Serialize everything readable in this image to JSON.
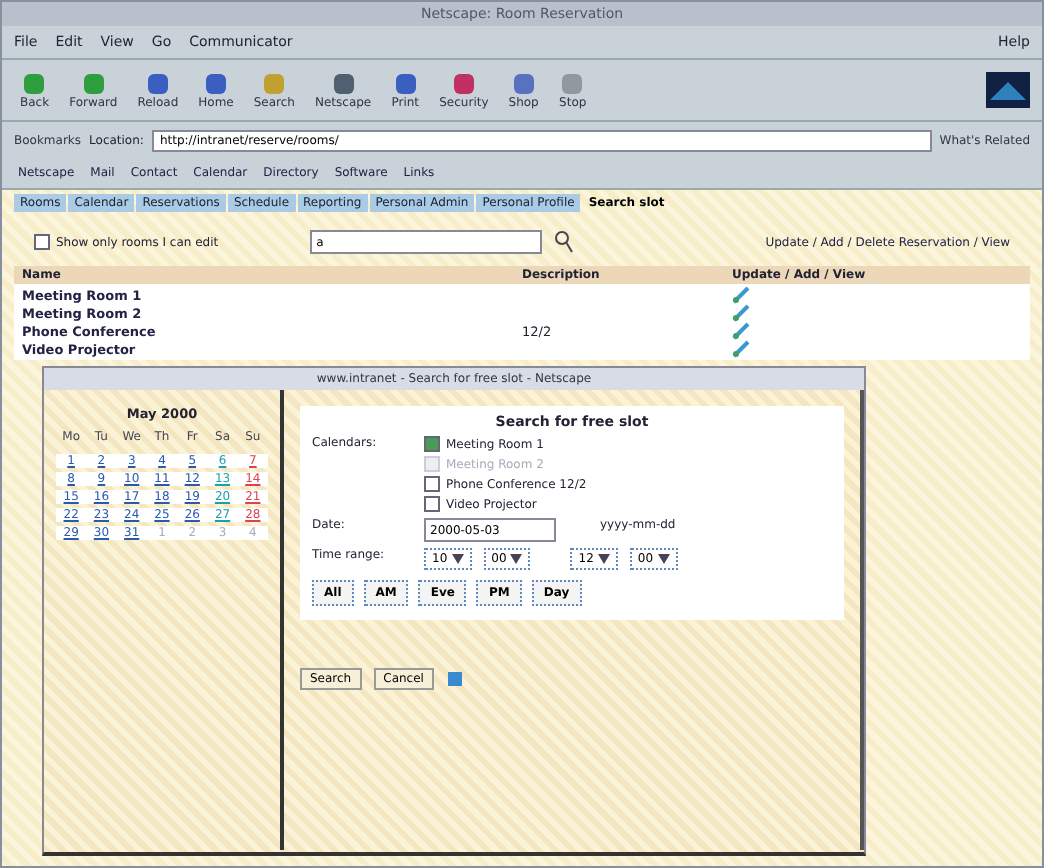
{
  "window": {
    "title": "Netscape: Room Reservation"
  },
  "menu": [
    "File",
    "Edit",
    "View",
    "Go",
    "Communicator"
  ],
  "help": "Help",
  "toolbar": [
    {
      "label": "Back",
      "color": "#2e9e3e"
    },
    {
      "label": "Forward",
      "color": "#2e9e3e"
    },
    {
      "label": "Reload",
      "color": "#3a5fc0"
    },
    {
      "label": "Home",
      "color": "#3a5fc0"
    },
    {
      "label": "Search",
      "color": "#c0a030"
    },
    {
      "label": "Netscape",
      "color": "#506070"
    },
    {
      "label": "Print",
      "color": "#3a5fc0"
    },
    {
      "label": "Security",
      "color": "#c03060"
    },
    {
      "label": "Shop",
      "color": "#5a70c0"
    },
    {
      "label": "Stop",
      "color": "#9098a0"
    }
  ],
  "location": {
    "bookmarks": "Bookmarks",
    "label": "Location:",
    "value": "http://intranet/reserve/rooms/",
    "related": "What's Related"
  },
  "personal": [
    "Netscape",
    "Mail",
    "Contact",
    "Calendar",
    "Directory",
    "Software",
    "Links"
  ],
  "tabs": [
    {
      "label": "Rooms",
      "selected": false
    },
    {
      "label": "Calendar",
      "selected": false
    },
    {
      "label": "Reservations",
      "selected": false
    },
    {
      "label": "Schedule",
      "selected": false
    },
    {
      "label": "Reporting",
      "selected": false
    },
    {
      "label": "Personal Admin",
      "selected": false
    },
    {
      "label": "Personal Profile",
      "selected": false
    },
    {
      "label": "Search slot",
      "selected": true
    }
  ],
  "filter": {
    "label": "Show only rooms I can edit",
    "checked": false,
    "value": "a"
  },
  "actions": "Update / Add / Delete Reservation / View",
  "table": {
    "columns": [
      "Name",
      "Description",
      "Update / Add / View"
    ],
    "rows": [
      {
        "name": "Meeting Room 1",
        "description": ""
      },
      {
        "name": "Meeting Room 2",
        "description": ""
      },
      {
        "name": "Phone Conference",
        "extra": "12/2"
      },
      {
        "name": "Video Projector",
        "extra": ""
      }
    ]
  },
  "popup": {
    "title": "www.intranet - Search for free slot - Netscape",
    "calendar": {
      "month": "May 2000",
      "weekdays": [
        "Mo",
        "Tu",
        "We",
        "Th",
        "Fr",
        "Sa",
        "Su"
      ],
      "weeks": [
        [
          "1",
          "2",
          "3",
          "4",
          "5",
          "6",
          "7"
        ],
        [
          "8",
          "9",
          "10",
          "11",
          "12",
          "13",
          "14"
        ],
        [
          "15",
          "16",
          "17",
          "18",
          "19",
          "20",
          "21"
        ],
        [
          "22",
          "23",
          "24",
          "25",
          "26",
          "27",
          "28"
        ],
        [
          "29",
          "30",
          "31",
          "1",
          "2",
          "3",
          "4"
        ]
      ]
    },
    "heading": "Search for free slot",
    "resources_label": "Calendars:",
    "resources": [
      {
        "label": "Meeting Room 1",
        "checked": true,
        "disabled": false
      },
      {
        "label": "Meeting Room 2",
        "checked": false,
        "disabled": true
      },
      {
        "label": "Phone Conference  12/2",
        "checked": false,
        "disabled": false
      },
      {
        "label": "Video Projector",
        "checked": false,
        "disabled": false
      }
    ],
    "date_label": "Date:",
    "date": "2000-05-03",
    "date_hint": "yyyy-mm-dd",
    "time_label": "Time range:",
    "times": [
      "10",
      "00",
      "12",
      "00"
    ],
    "presets": [
      "All",
      "AM",
      "Eve",
      "PM",
      "Day"
    ],
    "buttons": [
      "Search",
      "Cancel"
    ]
  }
}
